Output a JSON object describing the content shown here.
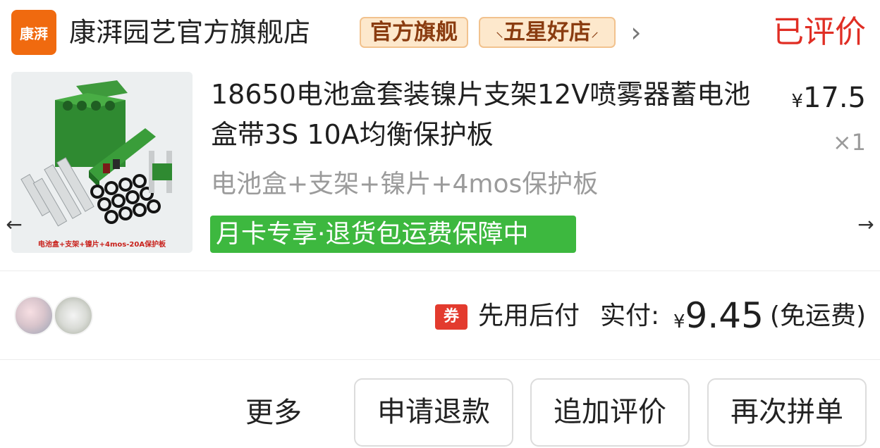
{
  "store": {
    "logo_text": "康湃",
    "name": "康湃园艺官方旗舰店",
    "badge_official": "官方旗舰",
    "badge_star": "五星好店",
    "order_status": "已评价"
  },
  "product": {
    "image_caption": "电池盒+支架+镍片+4mos-20A保护板",
    "title": "18650电池盒套装镍片支架12V喷雾器蓄电池盒带3S 10A均衡保护板",
    "currency": "¥",
    "price": "17.5",
    "quantity": "×1",
    "spec": "电池盒+支架+镍片+4mos保护板",
    "promo": "月卡专享·退货包运费保障中"
  },
  "payment": {
    "coupon_icon": "券",
    "pay_later": "先用后付",
    "paid_label": "实付:",
    "currency": "¥",
    "paid_amount": "9.45",
    "shipping_note": "(免运费)"
  },
  "actions": {
    "more": "更多",
    "refund": "申请退款",
    "add_review": "追加评价",
    "reorder": "再次拼单"
  },
  "icons": {
    "store_chevron": "chevron-right-icon",
    "scroll_left": "arrow-left-icon",
    "scroll_right": "arrow-right-icon"
  },
  "colors": {
    "status_red": "#e02e24",
    "promo_green": "#3db83f",
    "logo_orange": "#f06a0f",
    "badge_bg": "#fde8cc",
    "coupon_red": "#e33b2e"
  }
}
